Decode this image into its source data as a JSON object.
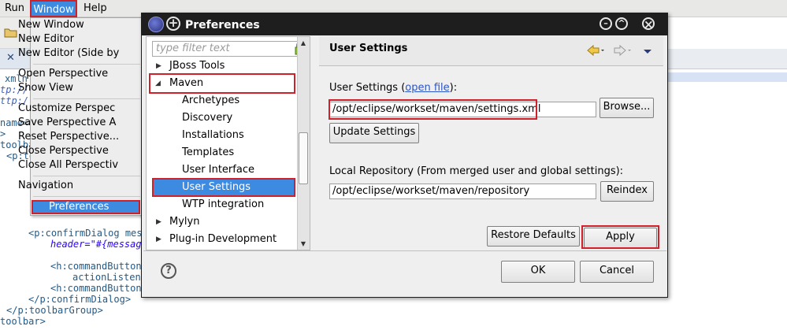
{
  "menubar": {
    "run": "Run",
    "window": "Window",
    "help": "Help"
  },
  "window_menu": {
    "items": [
      "New Window",
      "New Editor",
      "New Editor (Side by",
      "Open Perspective",
      "Show View",
      "Customize Perspec",
      "Save Perspective A",
      "Reset Perspective...",
      "Close Perspective",
      "Close All Perspectiv",
      "Navigation",
      "Preferences"
    ]
  },
  "code": {
    "lines": [
      "xmln",
      "tp://",
      "ttp:/",
      "name=",
      ">",
      "toolba",
      "<p:to",
      "<p:confirmDialog mess",
      "header=\"#{message",
      "<h:commandButton",
      "actionListene",
      "<h:commandButton",
      "</p:confirmDialog>",
      "</p:toolbarGroup>",
      "toolbar>"
    ]
  },
  "dialog": {
    "title": "Preferences",
    "filter_placeholder": "type filter text",
    "tree": [
      "JBoss Tools",
      "Maven",
      "Archetypes",
      "Discovery",
      "Installations",
      "Templates",
      "User Interface",
      "User Settings",
      "WTP integration",
      "Mylyn",
      "Plug-in Development"
    ],
    "page_title": "User Settings",
    "user_settings_label": "User Settings (",
    "open_file_link": "open file",
    "user_settings_label_end": "):",
    "settings_path": "/opt/eclipse/workset/maven/settings.xml",
    "browse_button": "Browse...",
    "update_button": "Update Settings",
    "local_repo_label": "Local Repository (From merged user and global settings):",
    "repo_path": "/opt/eclipse/workset/maven/repository",
    "reindex_button": "Reindex",
    "restore_button": "Restore Defaults",
    "apply_button": "Apply",
    "ok_button": "OK",
    "cancel_button": "Cancel"
  },
  "colors": {
    "selection": "#3d8be0",
    "highlight_box": "#d0202a",
    "titlebar": "#1e1e1e"
  }
}
